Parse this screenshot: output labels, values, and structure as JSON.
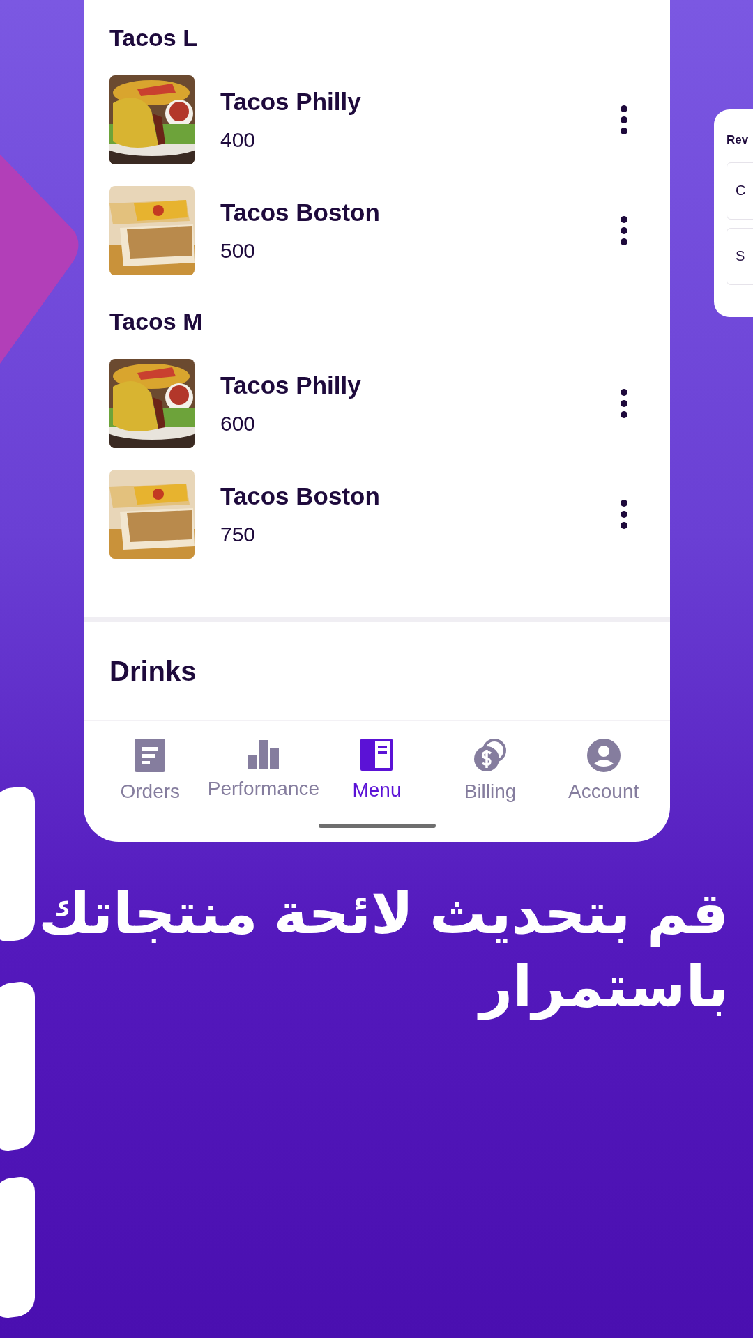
{
  "menu_sections": [
    {
      "title": "Tacos L",
      "items": [
        {
          "name": "Tacos Philly",
          "price": "400"
        },
        {
          "name": "Tacos Boston",
          "price": "500"
        }
      ]
    },
    {
      "title": "Tacos M",
      "items": [
        {
          "name": "Tacos Philly",
          "price": "600"
        },
        {
          "name": "Tacos Boston",
          "price": "750"
        }
      ]
    }
  ],
  "next_section": {
    "title": "Drinks"
  },
  "bottom_nav": [
    {
      "label": "Orders",
      "kind": "orders",
      "selected": false
    },
    {
      "label": "Performance",
      "kind": "performance",
      "selected": false
    },
    {
      "label": "Menu",
      "kind": "menu",
      "selected": true
    },
    {
      "label": "Billing",
      "kind": "billing",
      "selected": false
    },
    {
      "label": "Account",
      "kind": "account",
      "selected": false
    }
  ],
  "side_card": {
    "title": "Rev",
    "fields": [
      "C",
      "S"
    ]
  },
  "headline": [
    "قم بتحديث لائحة منتجاتك",
    "باستمرار"
  ]
}
